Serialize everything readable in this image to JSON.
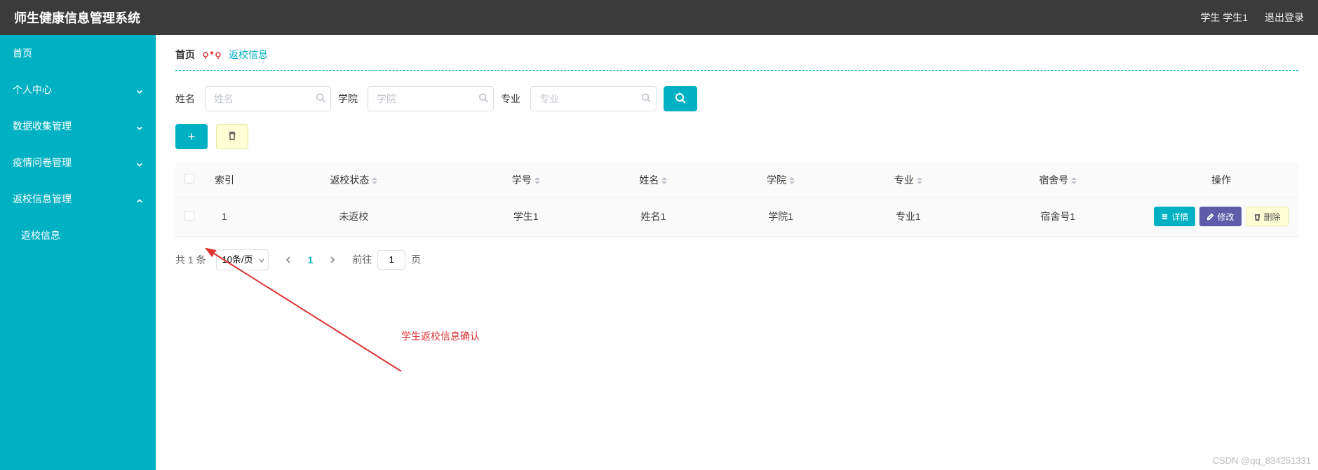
{
  "header": {
    "title": "师生健康信息管理系统",
    "user_label": "学生 学生1",
    "logout_label": "退出登录"
  },
  "sidebar": {
    "items": [
      {
        "label": "首页",
        "expandable": false
      },
      {
        "label": "个人中心",
        "expandable": true,
        "expanded": false
      },
      {
        "label": "数据收集管理",
        "expandable": true,
        "expanded": false
      },
      {
        "label": "疫情问卷管理",
        "expandable": true,
        "expanded": false
      },
      {
        "label": "返校信息管理",
        "expandable": true,
        "expanded": true,
        "children": [
          {
            "label": "返校信息"
          }
        ]
      }
    ]
  },
  "breadcrumb": {
    "home": "首页",
    "current": "返校信息"
  },
  "filters": {
    "name_label": "姓名",
    "name_placeholder": "姓名",
    "college_label": "学院",
    "college_placeholder": "学院",
    "major_label": "专业",
    "major_placeholder": "专业"
  },
  "table": {
    "columns": {
      "index": "索引",
      "return_status": "返校状态",
      "student_no": "学号",
      "name": "姓名",
      "college": "学院",
      "major": "专业",
      "dorm_no": "宿舍号",
      "actions": "操作"
    },
    "rows": [
      {
        "index": "1",
        "return_status": "未返校",
        "student_no": "学生1",
        "name": "姓名1",
        "college": "学院1",
        "major": "专业1",
        "dorm_no": "宿舍号1"
      }
    ],
    "action_labels": {
      "detail": "详情",
      "edit": "修改",
      "delete": "删除"
    }
  },
  "pagination": {
    "total_text": "共 1 条",
    "page_size_label": "10条/页",
    "current_page": "1",
    "jump_prefix": "前往",
    "jump_value": "1",
    "jump_suffix": "页"
  },
  "annotation": {
    "text": "学生返校信息确认"
  },
  "watermark": "CSDN @qq_834251331",
  "colors": {
    "accent": "#00b0c3",
    "danger": "#d33",
    "muted_yellow": "#ffffd6"
  }
}
